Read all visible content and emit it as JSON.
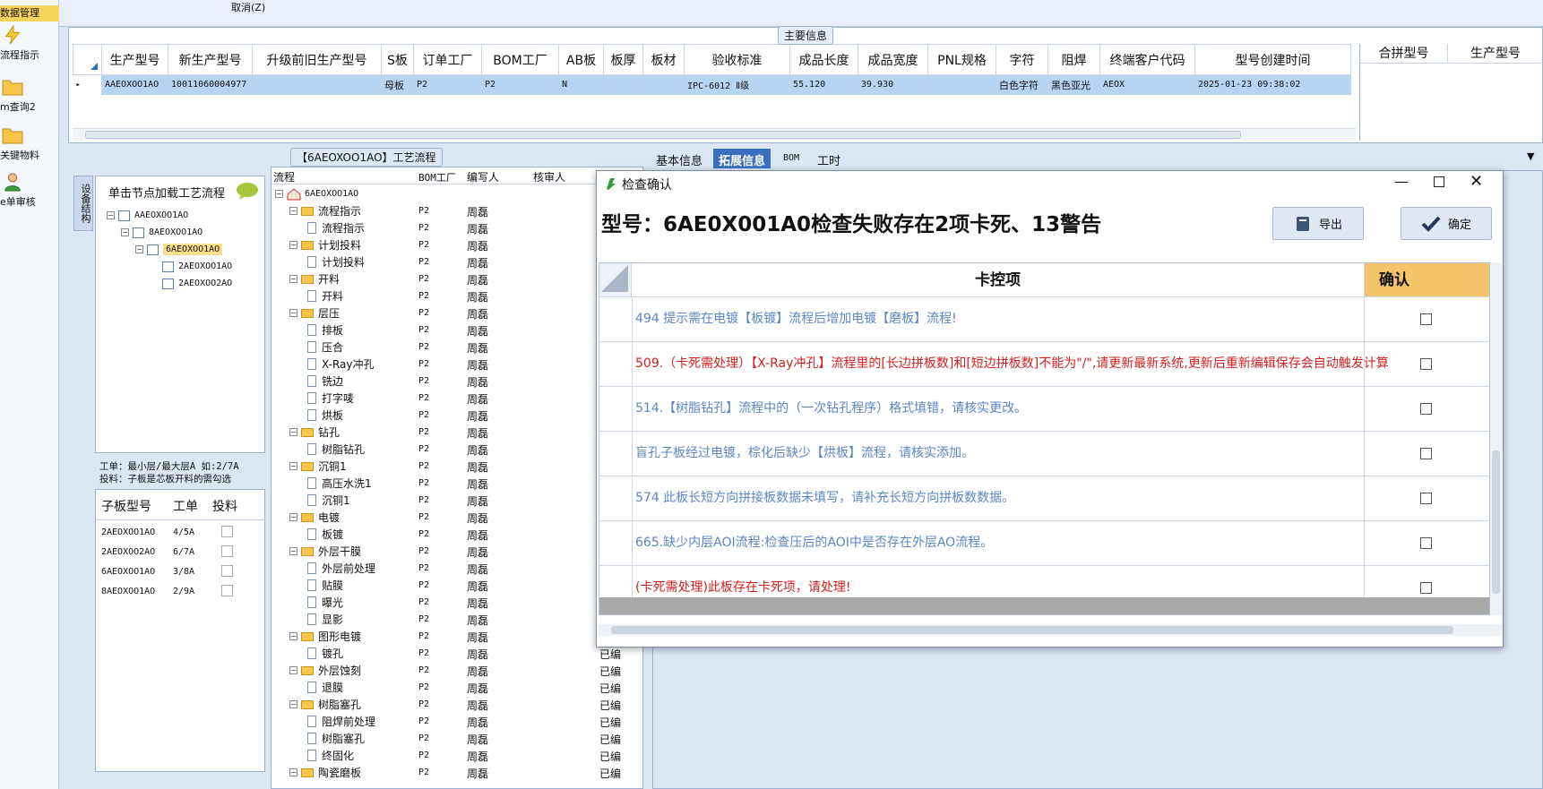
{
  "sidebar": {
    "items": [
      {
        "label": "数据管理",
        "icon": "database-icon"
      },
      {
        "label": "流程指示",
        "icon": "lightning-icon"
      },
      {
        "label": "m查询2",
        "icon": "folder-icon"
      },
      {
        "label": "关键物料",
        "icon": "folder-icon"
      },
      {
        "label": "e单审核",
        "icon": "user-icon"
      }
    ]
  },
  "topbar": {
    "cancel_label": "取消(Z)"
  },
  "main_info": {
    "tab": "主要信息",
    "columns": [
      "生产型号",
      "新生产型号",
      "升级前旧生产型号",
      "S板",
      "订单工厂",
      "BOM工厂",
      "AB板",
      "板厚",
      "板材",
      "验收标准",
      "成品长度",
      "成品宽度",
      "PNL规格",
      "字符",
      "阻焊",
      "终端客户代码",
      "型号创建时间"
    ],
    "row": [
      "AAEOXOO1AO",
      "10011060004977",
      "",
      "母板",
      "P2",
      "P2",
      "N",
      "",
      "",
      "IPC-6012 Ⅱ级",
      "55.120",
      "39.930",
      "",
      "白色字符",
      "黑色亚光",
      "AEOX",
      "2025-01-23 09:38:02"
    ],
    "right_columns": [
      "合拼型号",
      "生产型号"
    ]
  },
  "process": {
    "tab": "【6AEOXOO1AO】工艺流程",
    "side_tab": "设备结构",
    "hint": "单击节点加载工艺流程",
    "tree": [
      "AAEOXOO1AO",
      "8AEOXOO1AO",
      "6AEOXOO1AO",
      "2AEOXOO1AO",
      "2AEOXOO2AO"
    ],
    "note1": "工单：最小层/最大层A 如:2/7A",
    "note2": "投料：子板是芯板开料的需勾选",
    "sub_columns": [
      "子板型号",
      "工单",
      "投料"
    ],
    "sub_rows": [
      [
        "2AEOXOO1AO",
        "4/5A"
      ],
      [
        "2AEOXOO2AO",
        "6/7A"
      ],
      [
        "6AEOXOO1AO",
        "3/8A"
      ],
      [
        "8AEOXOO1AO",
        "2/9A"
      ]
    ],
    "flow_columns": [
      "流程",
      "BOM工厂",
      "编写人",
      "核审人"
    ],
    "flow_root": "6AEOXOO1AO",
    "flow_rows": [
      {
        "name": "流程指示",
        "type": "folder",
        "bom": "P2",
        "writer": "周磊"
      },
      {
        "name": "流程指示",
        "type": "doc",
        "bom": "P2",
        "writer": "周磊"
      },
      {
        "name": "计划投料",
        "type": "folder",
        "bom": "P2",
        "writer": "周磊"
      },
      {
        "name": "计划投料",
        "type": "doc",
        "bom": "P2",
        "writer": "周磊"
      },
      {
        "name": "开料",
        "type": "folder",
        "bom": "P2",
        "writer": "周磊"
      },
      {
        "name": "开料",
        "type": "doc",
        "bom": "P2",
        "writer": "周磊"
      },
      {
        "name": "层压",
        "type": "folder",
        "bom": "P2",
        "writer": "周磊"
      },
      {
        "name": "排板",
        "type": "doc",
        "bom": "P2",
        "writer": "周磊"
      },
      {
        "name": "压合",
        "type": "doc",
        "bom": "P2",
        "writer": "周磊"
      },
      {
        "name": "X-Ray冲孔",
        "type": "doc",
        "bom": "P2",
        "writer": "周磊"
      },
      {
        "name": "铣边",
        "type": "doc",
        "bom": "P2",
        "writer": "周磊"
      },
      {
        "name": "打字唛",
        "type": "doc",
        "bom": "P2",
        "writer": "周磊"
      },
      {
        "name": "烘板",
        "type": "doc",
        "bom": "P2",
        "writer": "周磊"
      },
      {
        "name": "钻孔",
        "type": "folder",
        "bom": "P2",
        "writer": "周磊"
      },
      {
        "name": "树脂钻孔",
        "type": "doc",
        "bom": "P2",
        "writer": "周磊"
      },
      {
        "name": "沉铜1",
        "type": "folder",
        "bom": "P2",
        "writer": "周磊"
      },
      {
        "name": "高压水洗1",
        "type": "doc",
        "bom": "P2",
        "writer": "周磊"
      },
      {
        "name": "沉铜1",
        "type": "doc",
        "bom": "P2",
        "writer": "周磊"
      },
      {
        "name": "电镀",
        "type": "folder",
        "bom": "P2",
        "writer": "周磊"
      },
      {
        "name": "板镀",
        "type": "doc",
        "bom": "P2",
        "writer": "周磊"
      },
      {
        "name": "外层干膜",
        "type": "folder",
        "bom": "P2",
        "writer": "周磊"
      },
      {
        "name": "外层前处理",
        "type": "doc",
        "bom": "P2",
        "writer": "周磊"
      },
      {
        "name": "贴膜",
        "type": "doc",
        "bom": "P2",
        "writer": "周磊"
      },
      {
        "name": "曝光",
        "type": "doc",
        "bom": "P2",
        "writer": "周磊"
      },
      {
        "name": "显影",
        "type": "doc",
        "bom": "P2",
        "writer": "周磊"
      },
      {
        "name": "图形电镀",
        "type": "folder",
        "bom": "P2",
        "writer": "周磊"
      },
      {
        "name": "镀孔",
        "type": "doc",
        "bom": "P2",
        "writer": "周磊"
      },
      {
        "name": "外层蚀刻",
        "type": "folder",
        "bom": "P2",
        "writer": "周磊"
      },
      {
        "name": "退膜",
        "type": "doc",
        "bom": "P2",
        "writer": "周磊"
      },
      {
        "name": "树脂塞孔",
        "type": "folder",
        "bom": "P2",
        "writer": "周磊"
      },
      {
        "name": "阻焊前处理",
        "type": "doc",
        "bom": "P2",
        "writer": "周磊"
      },
      {
        "name": "树脂塞孔",
        "type": "doc",
        "bom": "P2",
        "writer": "周磊"
      },
      {
        "name": "终固化",
        "type": "doc",
        "bom": "P2",
        "writer": "周磊"
      },
      {
        "name": "陶瓷磨板",
        "type": "folder",
        "bom": "P2",
        "writer": "周磊"
      }
    ],
    "reviewed": "已编"
  },
  "right_tabs": [
    "基本信息",
    "拓展信息",
    "BOM",
    "工时"
  ],
  "dialog": {
    "title": "检查确认",
    "heading": "型号：6AE0X001A0检查失败存在2项卡死、13警告",
    "export_label": "导出",
    "ok_label": "确定",
    "col_control": "卡控项",
    "col_confirm": "确认",
    "rows": [
      {
        "text": "494 提示需在电镀【板镀】流程后增加电镀【磨板】流程!",
        "color": "#5b86c5"
      },
      {
        "text": "509.（卡死需处理）【X-Ray冲孔】流程里的[长边拼板数]和[短边拼板数]不能为\"/\",请更新最新系统,更新后重新编辑保存会自动触发计算",
        "color": "#d42020"
      },
      {
        "text": "514.【树脂钻孔】流程中的（一次钻孔程序）格式填错，请核实更改。",
        "color": "#5b86c5"
      },
      {
        "text": "盲孔子板经过电镀，棕化后缺少【烘板】流程，请核实添加。",
        "color": "#5b86c5"
      },
      {
        "text": "574 此板长短方向拼接板数据未填写，请补充长短方向拼板数数据。",
        "color": "#5b86c5"
      },
      {
        "text": "665.缺少内层AOI流程:检查压后的AOI中是否存在外层AO流程。",
        "color": "#5b86c5"
      },
      {
        "text": "(卡死需处理)此板存在卡死项，请处理!",
        "color": "#d42020"
      }
    ]
  }
}
